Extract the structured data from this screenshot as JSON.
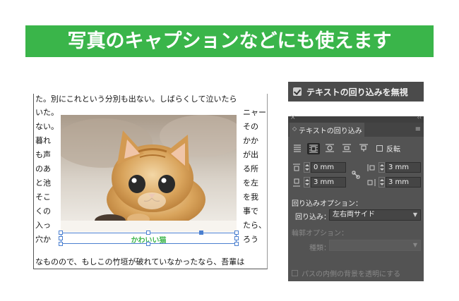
{
  "banner": {
    "title": "写真のキャプションなどにも使えます"
  },
  "document": {
    "top_line": "た。別にこれという分別も出ない。しばらくして泣いたら",
    "bottom_line": "なものので、もしこの竹垣が破れていなかったなら、吾輩は",
    "left_column": [
      "いた。",
      "ない。",
      "暮れ",
      "も声",
      "のあ",
      "と池",
      "そこ",
      "くの",
      "入っ",
      "穴か"
    ],
    "right_column": [
      "ニャー",
      "その",
      "かか",
      "が出",
      "る所",
      "を左",
      "を我",
      "事で",
      "たら、",
      "ろう"
    ]
  },
  "caption": {
    "text": "かわいい猫"
  },
  "ignore_wrap": {
    "label": "テキストの回り込みを無視",
    "checked": true
  },
  "wrap_panel": {
    "title": "テキストの回り込み",
    "invert_label": "反転",
    "offsets": {
      "top": "0 mm",
      "bottom": "3 mm",
      "left": "3 mm",
      "right": "3 mm"
    },
    "wrap_options_label": "回り込みオプション：",
    "wrap_to_label": "回り込み：",
    "wrap_to_value": "左右両サイド",
    "contour_options_label": "輪郭オプション：",
    "type_label": "種類：",
    "type_value": "",
    "inside_edges_label": "パスの内側の背景を透明にする"
  },
  "colors": {
    "accent_green": "#3ab54a",
    "selection_blue": "#4a7fd0",
    "panel_bg": "#535353"
  }
}
